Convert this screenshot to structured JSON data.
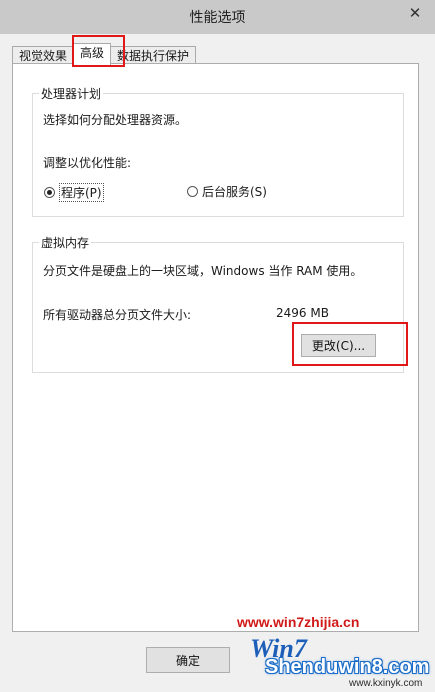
{
  "window": {
    "title": "性能选项",
    "close_glyph": "✕"
  },
  "tabs": [
    {
      "label": "视觉效果",
      "active": false
    },
    {
      "label": "高级",
      "active": true
    },
    {
      "label": "数据执行保护",
      "active": false
    }
  ],
  "processor": {
    "title": "处理器计划",
    "description": "选择如何分配处理器资源。",
    "adjust_label": "调整以优化性能:",
    "options": [
      {
        "label": "程序(P)",
        "checked": true
      },
      {
        "label": "后台服务(S)",
        "checked": false
      }
    ]
  },
  "virtual_memory": {
    "title": "虚拟内存",
    "description": "分页文件是硬盘上的一块区域，Windows 当作 RAM 使用。",
    "total_label": "所有驱动器总分页文件大小:",
    "total_value": "2496 MB",
    "change_button": "更改(C)..."
  },
  "footer": {
    "ok_button": "确定"
  },
  "watermark": {
    "url": "www.win7zhijia.cn",
    "logo_text": "Shenduwin8.com",
    "logo_sub": "www.kxinyk.com",
    "logo_prefix": "Win7"
  },
  "colors": {
    "highlight": "#e01818",
    "titlebar": "#c9c9c9",
    "panel": "#ffffff"
  }
}
